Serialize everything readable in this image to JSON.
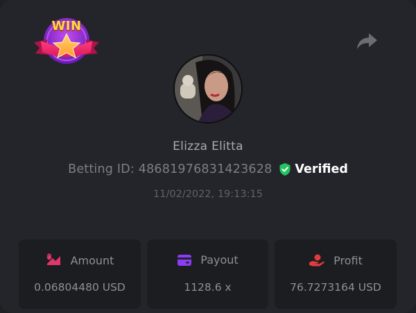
{
  "header": {
    "badge_text": "WIN",
    "badge_icon": "win-star-badge",
    "share_icon": "share-arrow-icon"
  },
  "profile": {
    "username": "Elizza Elitta",
    "betting_id": "Betting ID: 48681976831423628",
    "verified_label": "Verified",
    "timestamp": "11/02/2022, 19:13:15"
  },
  "stats": [
    {
      "label": "Amount",
      "value": "0.06804480 USD",
      "icon": "amount-icon",
      "color": "#e0366a"
    },
    {
      "label": "Payout",
      "value": "1128.6 x",
      "icon": "card-icon",
      "color": "#8b3df5"
    },
    {
      "label": "Profit",
      "value": "76.7273164 USD",
      "icon": "hand-coin-icon",
      "color": "#e23b3b"
    }
  ],
  "colors": {
    "background": "#24252a",
    "panel": "#1c1d21",
    "verified_green": "#22c55e"
  }
}
